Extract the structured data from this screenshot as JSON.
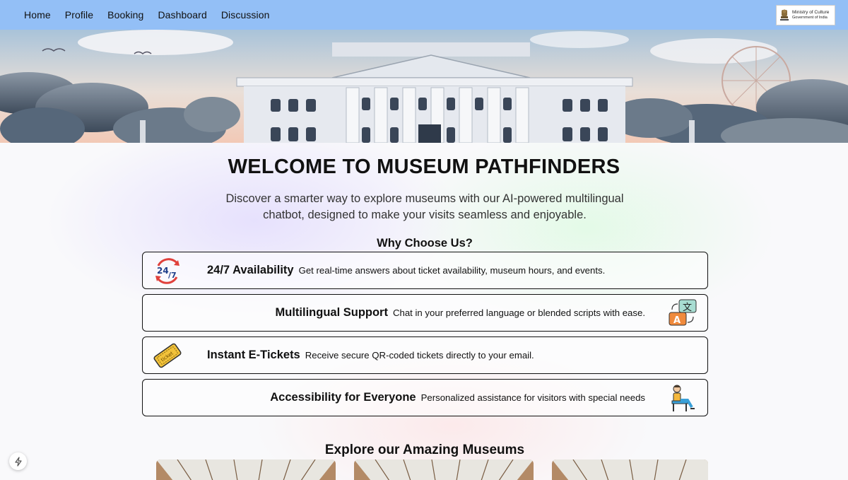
{
  "nav": {
    "links": [
      "Home",
      "Profile",
      "Booking",
      "Dashboard",
      "Discussion"
    ],
    "logo": {
      "line1": "Ministry of Culture",
      "line2": "Government of India"
    }
  },
  "hero": {
    "image": "museum-building-illustration"
  },
  "main": {
    "title": "WELCOME TO MUSEUM PATHFINDERS",
    "tagline": "Discover a smarter way to explore museums with our AI-powered multilingual chatbot, designed to make your visits seamless and enjoyable.",
    "why_title": "Why Choose Us?",
    "features": [
      {
        "title": "24/7 Availability",
        "desc": "Get real-time answers about ticket availability, museum hours, and events.",
        "icon": "24-7-icon"
      },
      {
        "title": "Multilingual Support",
        "desc": "Chat in your preferred language or blended scripts with ease.",
        "icon": "translate-icon"
      },
      {
        "title": "Instant E-Tickets",
        "desc": "Receive secure QR-coded tickets directly to your email.",
        "icon": "ticket-icon"
      },
      {
        "title": "Accessibility for Everyone",
        "desc": "Personalized assistance for visitors with special needs",
        "icon": "accessibility-icon"
      }
    ],
    "explore_title": "Explore our Amazing Museums"
  },
  "colors": {
    "navbar": "#93bff6",
    "border": "#111111"
  }
}
